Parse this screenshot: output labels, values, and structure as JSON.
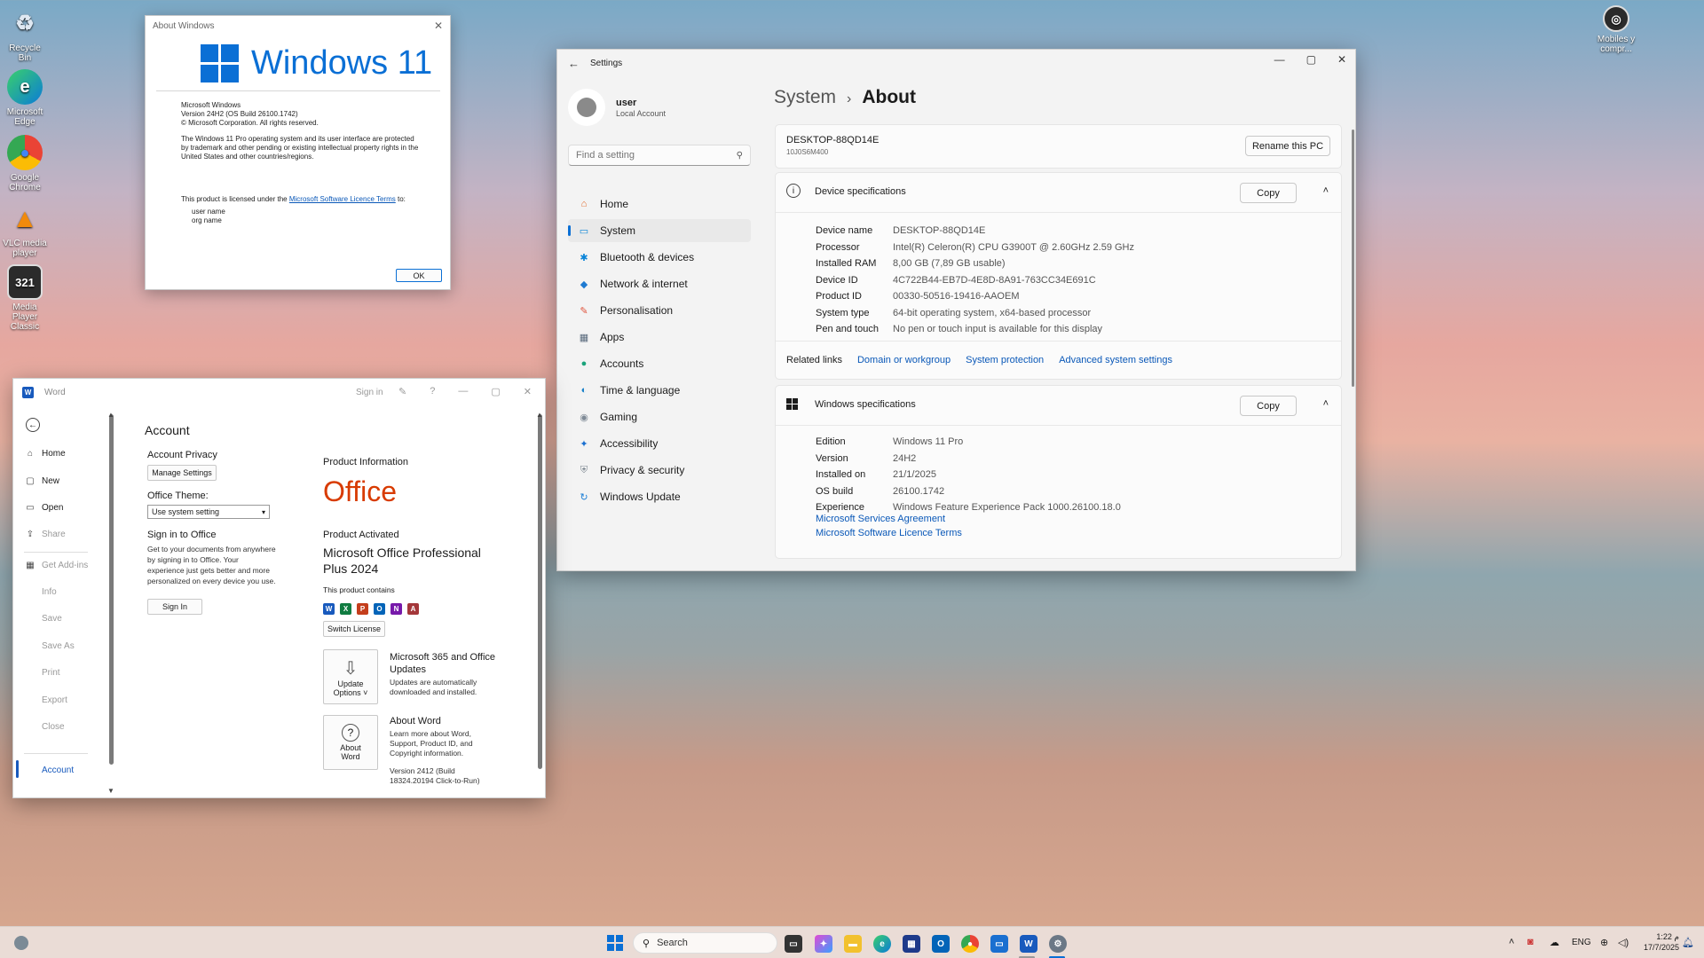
{
  "desktop": {
    "icons": [
      {
        "label": "Recycle Bin",
        "glyph": "♻"
      },
      {
        "label": "Microsoft Edge",
        "glyph": "e"
      },
      {
        "label": "Google Chrome",
        "glyph": "●"
      },
      {
        "label": "VLC media player",
        "glyph": "▲"
      },
      {
        "label": "Media Player Classic",
        "glyph": "321"
      }
    ],
    "top_right_icon": {
      "label": "Mobiles y compr..."
    }
  },
  "about_windows": {
    "title": "About Windows",
    "logo_text": "Windows 11",
    "product": "Microsoft Windows",
    "version": "Version 24H2 (OS Build 26100.1742)",
    "copyright": "© Microsoft Corporation. All rights reserved.",
    "legal": "The Windows 11 Pro operating system and its user interface are protected by trademark and other pending or existing intellectual property rights in the United States and other countries/regions.",
    "license_prefix": "This product is licensed under the",
    "license_link": "Microsoft Software Licence Terms",
    "license_suffix": "to:",
    "user_name": "user name",
    "org_name": "org name",
    "ok_label": "OK"
  },
  "settings": {
    "title": "Settings",
    "user": {
      "name": "user",
      "account_type": "Local Account"
    },
    "search_placeholder": "Find a setting",
    "nav": [
      {
        "label": "Home",
        "glyph": "⌂",
        "color": "#e06a2c"
      },
      {
        "label": "System",
        "glyph": "▭",
        "color": "#0a84d8"
      },
      {
        "label": "Bluetooth & devices",
        "glyph": "✱",
        "color": "#0a84d8"
      },
      {
        "label": "Network & internet",
        "glyph": "◆",
        "color": "#1f7ad1"
      },
      {
        "label": "Personalisation",
        "glyph": "✎",
        "color": "#e0533c"
      },
      {
        "label": "Apps",
        "glyph": "▦",
        "color": "#5a6b7d"
      },
      {
        "label": "Accounts",
        "glyph": "●",
        "color": "#1aa37a"
      },
      {
        "label": "Time & language",
        "glyph": "◐",
        "color": "#1780c8"
      },
      {
        "label": "Gaming",
        "glyph": "◉",
        "color": "#7f8a96"
      },
      {
        "label": "Accessibility",
        "glyph": "✦",
        "color": "#1a6fd0"
      },
      {
        "label": "Privacy & security",
        "glyph": "⛨",
        "color": "#7d8790"
      },
      {
        "label": "Windows Update",
        "glyph": "↻",
        "color": "#1a7ed6"
      }
    ],
    "breadcrumb_parent": "System",
    "breadcrumb_sep": "›",
    "breadcrumb_current": "About",
    "pc_name": "DESKTOP-88QD14E",
    "pc_model": "10J0S6M400",
    "rename_label": "Rename this PC",
    "device_specs": {
      "title": "Device specifications",
      "copy_label": "Copy",
      "rows": [
        {
          "k": "Device name",
          "v": "DESKTOP-88QD14E"
        },
        {
          "k": "Processor",
          "v": "Intel(R) Celeron(R) CPU G3900T @ 2.60GHz   2.59 GHz"
        },
        {
          "k": "Installed RAM",
          "v": "8,00 GB (7,89 GB usable)"
        },
        {
          "k": "Device ID",
          "v": "4C722B44-EB7D-4E8D-8A91-763CC34E691C"
        },
        {
          "k": "Product ID",
          "v": "00330-50516-19416-AAOEM"
        },
        {
          "k": "System type",
          "v": "64-bit operating system, x64-based processor"
        },
        {
          "k": "Pen and touch",
          "v": "No pen or touch input is available for this display"
        }
      ]
    },
    "related_links": {
      "label": "Related links",
      "links": [
        "Domain or workgroup",
        "System protection",
        "Advanced system settings"
      ]
    },
    "windows_specs": {
      "title": "Windows specifications",
      "copy_label": "Copy",
      "rows": [
        {
          "k": "Edition",
          "v": "Windows 11 Pro"
        },
        {
          "k": "Version",
          "v": "24H2"
        },
        {
          "k": "Installed on",
          "v": "21/1/2025"
        },
        {
          "k": "OS build",
          "v": "26100.1742"
        },
        {
          "k": "Experience",
          "v": "Windows Feature Experience Pack 1000.26100.18.0"
        }
      ],
      "links": [
        "Microsoft Services Agreement",
        "Microsoft Software Licence Terms"
      ]
    }
  },
  "word": {
    "title": "Word",
    "sign_in_top": "Sign in",
    "nav": [
      {
        "label": "Home",
        "glyph": "⌂",
        "dim": false
      },
      {
        "label": "New",
        "glyph": "▢",
        "dim": false
      },
      {
        "label": "Open",
        "glyph": "▭",
        "dim": false
      },
      {
        "label": "Share",
        "glyph": "⇪",
        "dim": true
      },
      {
        "label": "Get Add-ins",
        "glyph": "▦",
        "dim": true
      },
      {
        "label": "Info",
        "glyph": "",
        "dim": true
      },
      {
        "label": "Save",
        "glyph": "",
        "dim": true
      },
      {
        "label": "Save As",
        "glyph": "",
        "dim": true
      },
      {
        "label": "Print",
        "glyph": "",
        "dim": true
      },
      {
        "label": "Export",
        "glyph": "",
        "dim": true
      },
      {
        "label": "Close",
        "glyph": "",
        "dim": true
      }
    ],
    "nav_account": "Account",
    "heading": "Account",
    "privacy_title": "Account Privacy",
    "manage_settings": "Manage Settings",
    "theme_title": "Office Theme:",
    "theme_value": "Use system setting",
    "signin_title": "Sign in to Office",
    "signin_text": "Get to your documents from anywhere by signing in to Office. Your experience just gets better and more personalized on every device you use.",
    "signin_button": "Sign In",
    "product_info": "Product Information",
    "office_logo": "Office",
    "product_activated": "Product Activated",
    "product_name": "Microsoft Office Professional Plus 2024",
    "contains": "This product contains",
    "app_icons": [
      {
        "letter": "W",
        "color": "#185abd"
      },
      {
        "letter": "X",
        "color": "#107c41"
      },
      {
        "letter": "P",
        "color": "#c43e1c"
      },
      {
        "letter": "O",
        "color": "#0364b8"
      },
      {
        "letter": "N",
        "color": "#7719aa"
      },
      {
        "letter": "A",
        "color": "#a4373a"
      }
    ],
    "switch_license": "Switch License",
    "update_options": "Update Options ˅",
    "updates_title": "Microsoft 365 and Office Updates",
    "updates_text": "Updates are automatically downloaded and installed.",
    "about_label": "About Word",
    "about_title": "About Word",
    "about_text": "Learn more about Word, Support, Product ID, and Copyright information.",
    "about_version": "Version 2412 (Build 18324.20194 Click-to-Run)"
  },
  "taskbar": {
    "search_placeholder": "Search",
    "lang": "ENG",
    "time": "1:22 م",
    "date": "17/7/2025"
  }
}
